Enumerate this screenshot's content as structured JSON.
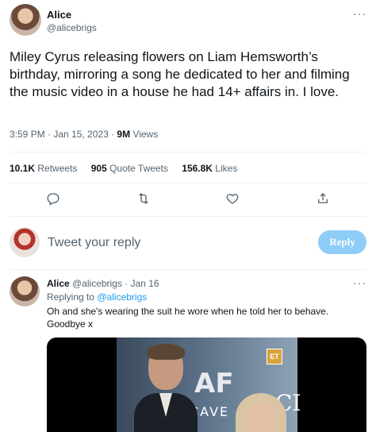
{
  "tweet": {
    "author_name": "Alice",
    "author_handle": "@alicebrigs",
    "more_icon": "more-horizontal-icon",
    "text": "Miley Cyrus releasing flowers on Liam Hemsworth’s birthday, mirroring a song he dedicated to her and filming the music video in a house he had 14+ affairs in. I love.",
    "time": "3:59 PM · Jan 15, 2023 · ",
    "views_count": "9M",
    "views_label": " Views",
    "stats": {
      "retweets_count": "10.1K",
      "retweets_label": " Retweets",
      "quotes_count": "905",
      "quotes_label": " Quote Tweets",
      "likes_count": "156.8K",
      "likes_label": " Likes"
    },
    "actions": [
      "reply-icon",
      "retweet-icon",
      "like-icon",
      "share-icon"
    ]
  },
  "reply_composer": {
    "placeholder": "Tweet your reply",
    "button_label": "Reply"
  },
  "reply": {
    "author_name": "Alice",
    "author_handle": " @alicebrigs · Jan 16",
    "replying_prefix": "Replying to ",
    "replying_to": "@alicebrigs",
    "text": "Oh and she's wearing the suit he wore when he told her to behave. Goodbye x",
    "media": {
      "badge": "ET",
      "backdrop_text_1": "AF",
      "backdrop_text_2": "CAVE",
      "backdrop_text_3": "CI"
    }
  },
  "colors": {
    "accent": "#1d9bf0",
    "reply_button": "#8ecdf8",
    "muted": "#536471",
    "text": "#0f1419"
  }
}
